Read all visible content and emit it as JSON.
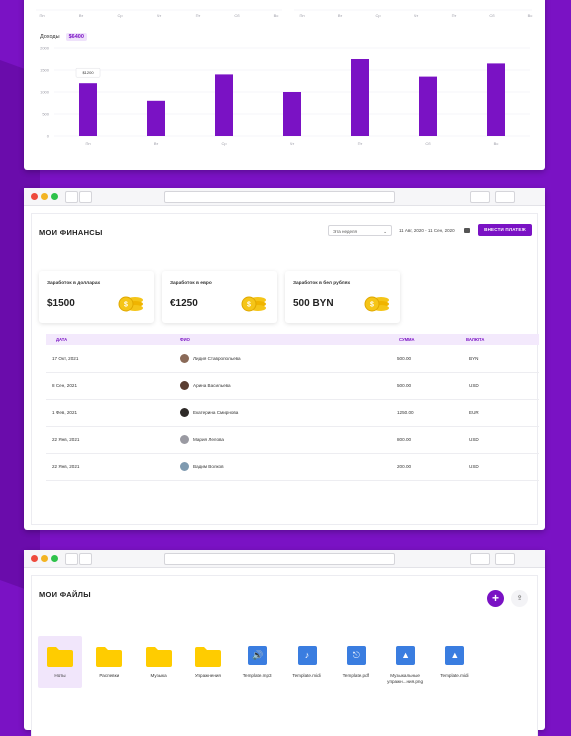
{
  "top_chart": {
    "upper_tick_labels_left": [
      "Пн",
      "Вт",
      "Ср",
      "Чт",
      "Пт",
      "Сб",
      "Вс"
    ],
    "upper_tick_labels_right": [
      "Пн",
      "Вт",
      "Ср",
      "Чт",
      "Пт",
      "Сб",
      "Вс"
    ],
    "income_label": "Доходы",
    "income_total": "$6400",
    "tooltip": "$1200"
  },
  "chart_data": {
    "type": "bar",
    "categories": [
      "Пн",
      "Вт",
      "Ср",
      "Чт",
      "Пт",
      "Сб",
      "Вс"
    ],
    "values": [
      1200,
      800,
      1400,
      1000,
      1750,
      1350,
      1650
    ],
    "ylim": [
      0,
      2000
    ],
    "yticks": [
      "2000",
      "1500",
      "1000",
      "500",
      "0"
    ],
    "color": "#7a12c4",
    "grid": true
  },
  "finance": {
    "title": "МОИ ФИНАНСЫ",
    "period": "Эта неделя",
    "date_range": "11 Авг, 2020 - 11 Сен, 2020",
    "add_payment": "ВНЕСТИ ПЛАТЕЖ",
    "cards": [
      {
        "label": "Заработок в долларах",
        "value": "$1500"
      },
      {
        "label": "Заработок в евро",
        "value": "€1250"
      },
      {
        "label": "Заработок в бел рублях",
        "value": "500 BYN"
      }
    ],
    "columns": [
      "ДАТА",
      "ФИО",
      "СУММА",
      "ВАЛЮТА"
    ],
    "rows": [
      {
        "date": "17 Окт, 2021",
        "name": "Лидия Ставропольева",
        "sum": "500.00",
        "currency": "BYN",
        "avatar_color": "#8a6a58"
      },
      {
        "date": "8 Сен, 2021",
        "name": "Арина Васильева",
        "sum": "500.00",
        "currency": "USD",
        "avatar_color": "#5a3e32"
      },
      {
        "date": "1 Фев, 2021",
        "name": "Екатерина Смирнова",
        "sum": "1250.00",
        "currency": "EUR",
        "avatar_color": "#2e2a28"
      },
      {
        "date": "22 Янв, 2021",
        "name": "Мария Лелова",
        "sum": "800.00",
        "currency": "USD",
        "avatar_color": "#9a9aa2"
      },
      {
        "date": "22 Янв, 2021",
        "name": "Вадим Волков",
        "sum": "200.00",
        "currency": "USD",
        "avatar_color": "#7f9ab0"
      }
    ]
  },
  "files": {
    "title": "МОИ ФАЙЛЫ",
    "items": [
      {
        "label": "Ноты",
        "kind": "folder",
        "icon": "folder-icon"
      },
      {
        "label": "Распевки",
        "kind": "folder",
        "icon": "folder-icon"
      },
      {
        "label": "Музыка",
        "kind": "folder",
        "icon": "folder-icon"
      },
      {
        "label": "Упражнения",
        "kind": "folder",
        "icon": "folder-icon"
      },
      {
        "label": "Template.mp3",
        "kind": "audio",
        "icon": "speaker-icon"
      },
      {
        "label": "Template.midi",
        "kind": "midi",
        "icon": "music-note-icon"
      },
      {
        "label": "Template.pdf",
        "kind": "pdf",
        "icon": "pdf-icon"
      },
      {
        "label": "Музыкальные упражн...ния.png",
        "kind": "image",
        "icon": "image-icon"
      },
      {
        "label": "Template.midi",
        "kind": "image",
        "icon": "image-icon"
      }
    ]
  },
  "colors": {
    "accent": "#7a12c4",
    "folder": "#ffcc00",
    "file_icon": "#3a7de0",
    "coin": "#f5c518"
  }
}
